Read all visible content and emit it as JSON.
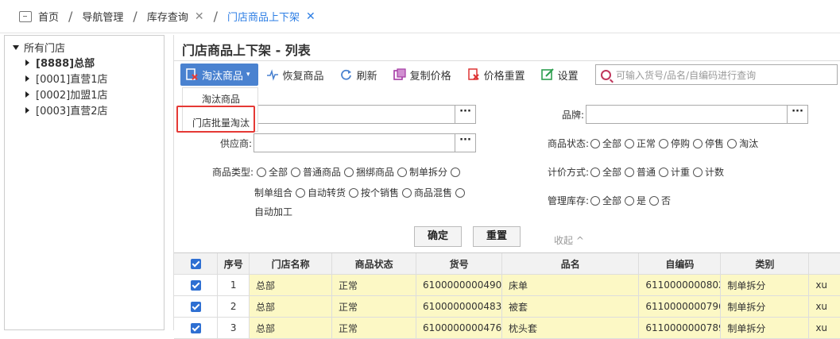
{
  "breadcrumb": [
    {
      "label": "首页",
      "closable": false
    },
    {
      "label": "导航管理",
      "closable": false
    },
    {
      "label": "库存查询",
      "closable": true
    },
    {
      "label": "门店商品上下架",
      "closable": true,
      "active": true
    }
  ],
  "tree": {
    "root": "所有门店",
    "nodes": [
      "[8888]总部",
      "[0001]直营1店",
      "[0002]加盟1店",
      "[0003]直营2店"
    ]
  },
  "page_title": "门店商品上下架 - 列表",
  "toolbar": {
    "eliminate": "淘汰商品",
    "restore": "恢复商品",
    "refresh": "刷新",
    "copy_price": "复制价格",
    "reset_price": "价格重置",
    "settings": "设置"
  },
  "search": {
    "placeholder": "可输入货号/品名/自编码进行查询"
  },
  "dropdown": {
    "item1": "淘汰商品",
    "item2": "门店批量淘汰"
  },
  "form": {
    "brand_label": "品牌:",
    "supplier_label": "供应商:",
    "status_label": "商品状态:",
    "status_options": [
      "全部",
      "正常",
      "停购",
      "停售",
      "淘汰"
    ],
    "type_label": "商品类型:",
    "type_options_line1": [
      "全部",
      "普通商品",
      "捆绑商品",
      "制单拆分"
    ],
    "type_options_line2": [
      "制单组合",
      "自动转货",
      "按个销售",
      "商品混售"
    ],
    "type_options_line3": "自动加工",
    "pricing_label": "计价方式:",
    "pricing_options": [
      "全部",
      "普通",
      "计重",
      "计数"
    ],
    "stock_label": "管理库存:",
    "stock_options": [
      "全部",
      "是",
      "否"
    ],
    "ok": "确定",
    "reset": "重置",
    "collapse": "收起 ^"
  },
  "table": {
    "headers": [
      "序号",
      "门店名称",
      "商品状态",
      "货号",
      "品名",
      "自编码",
      "类别"
    ],
    "rows": [
      [
        "1",
        "总部",
        "正常",
        "6100000000490",
        "床单",
        "6110000000802",
        "制单拆分",
        "xu"
      ],
      [
        "2",
        "总部",
        "正常",
        "6100000000483",
        "被套",
        "6110000000796",
        "制单拆分",
        "xu"
      ],
      [
        "3",
        "总部",
        "正常",
        "6100000000476",
        "枕头套",
        "6110000000789",
        "制单拆分",
        "xu"
      ]
    ]
  }
}
